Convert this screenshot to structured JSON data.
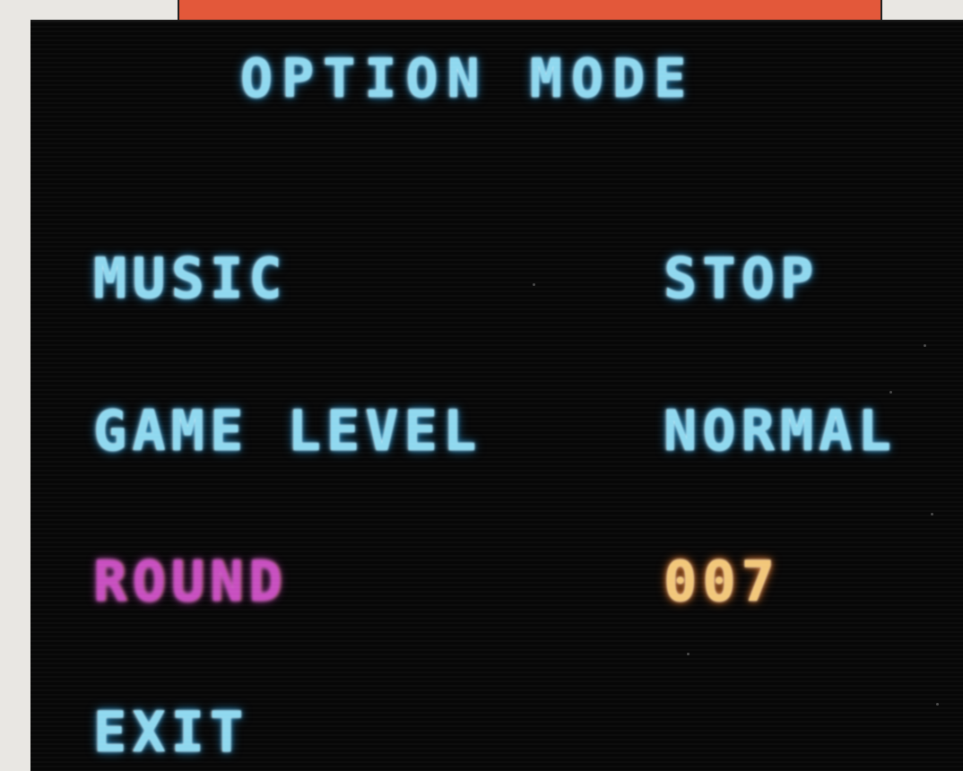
{
  "menu": {
    "title": "OPTION MODE",
    "items": [
      {
        "label": "MUSIC",
        "value": "STOP"
      },
      {
        "label": "GAME LEVEL",
        "value": "NORMAL"
      },
      {
        "label": "ROUND",
        "value": "007"
      },
      {
        "label": "EXIT"
      }
    ],
    "selected_item": "ROUND"
  },
  "colors": {
    "menu_text": "#8fd8ef",
    "selected_label": "#c84fc0",
    "round_value": "#f2c77a",
    "screen_background": "#070707",
    "banner": "#e3583a"
  }
}
